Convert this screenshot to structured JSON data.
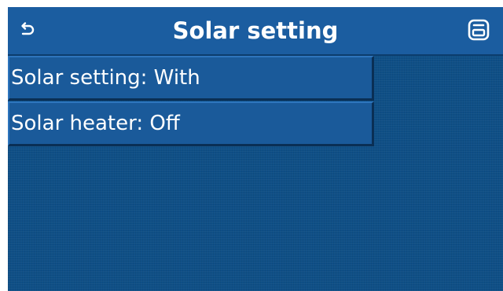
{
  "header": {
    "title": "Solar setting",
    "back_icon": "back-arrow-icon",
    "save_icon": "save-disk-icon"
  },
  "menu": {
    "items": [
      {
        "label": "Solar setting: With"
      },
      {
        "label": "Solar heater: Off"
      }
    ]
  },
  "colors": {
    "background": "#0f4f86",
    "header": "#1b5da0",
    "item": "#1a5a9a",
    "text": "#ffffff"
  }
}
